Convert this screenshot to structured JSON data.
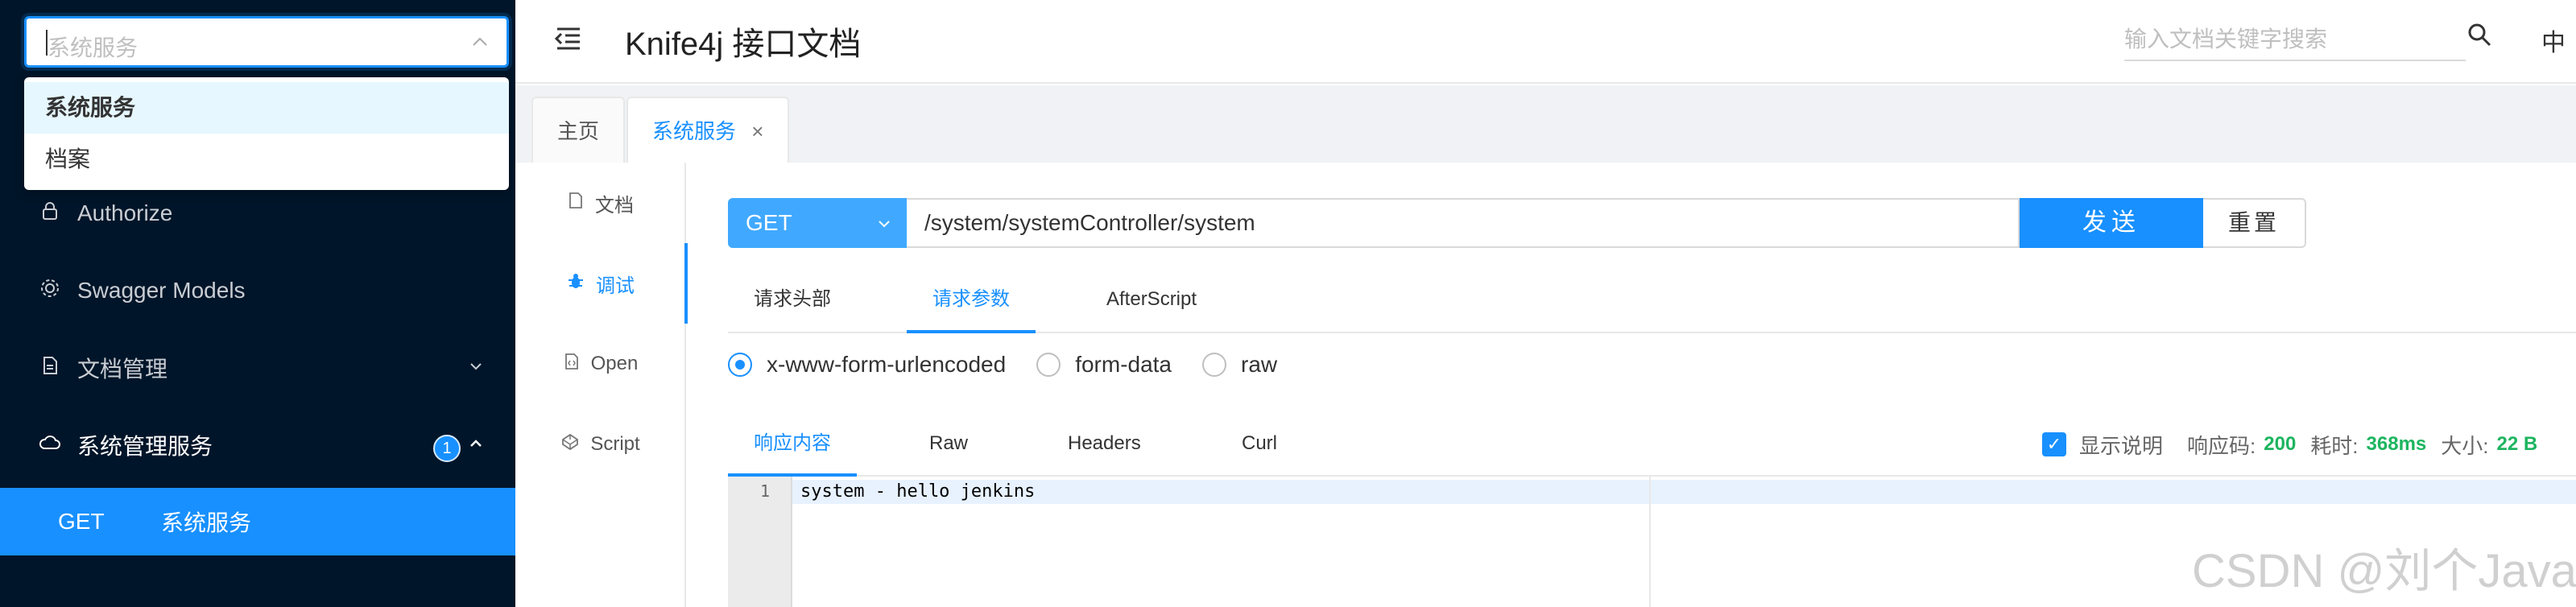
{
  "sidebar": {
    "service_select": {
      "placeholder": "系统服务"
    },
    "dropdown_options": [
      "系统服务",
      "档案"
    ],
    "menu": [
      {
        "label": "Authorize",
        "icon": "lock-icon"
      },
      {
        "label": "Swagger Models",
        "icon": "gear-icon"
      },
      {
        "label": "文档管理",
        "icon": "document-icon",
        "arrow": "chevron-down-icon"
      },
      {
        "label": "系统管理服务",
        "icon": "cloud-icon",
        "badge": "1",
        "arrow": "chevron-up-icon"
      }
    ],
    "active_api": {
      "method": "GET",
      "label": "系统服务"
    }
  },
  "header": {
    "title": "Knife4j 接口文档",
    "search_placeholder": "输入文档关键字搜索",
    "lang": "中"
  },
  "tabs": [
    {
      "label": "主页"
    },
    {
      "label": "系统服务",
      "close": "×"
    }
  ],
  "subnav": [
    {
      "label": "文档",
      "icon": "file-icon"
    },
    {
      "label": "调试",
      "icon": "bug-icon"
    },
    {
      "label": "Open",
      "icon": "file-code-icon"
    },
    {
      "label": "Script",
      "icon": "codepen-icon"
    }
  ],
  "request": {
    "method": "GET",
    "url": "/system/systemController/system",
    "send_label": "发送",
    "reset_label": "重置"
  },
  "request_tabs": [
    "请求头部",
    "请求参数",
    "AfterScript"
  ],
  "content_types": [
    "x-www-form-urlencoded",
    "form-data",
    "raw"
  ],
  "response_tabs": [
    "响应内容",
    "Raw",
    "Headers",
    "Curl"
  ],
  "response_meta": {
    "show_desc": "显示说明",
    "status_label": "响应码:",
    "status_value": "200",
    "time_label": "耗时:",
    "time_value": "368ms",
    "size_label": "大小:",
    "size_value": "22 B"
  },
  "editor": {
    "line_number": "1",
    "code": "system - hello jenkins"
  },
  "watermark": "CSDN @刘个Java",
  "colors": {
    "sidebar_bg": "#001529",
    "primary": "#1890ff",
    "success": "#1db55f"
  }
}
